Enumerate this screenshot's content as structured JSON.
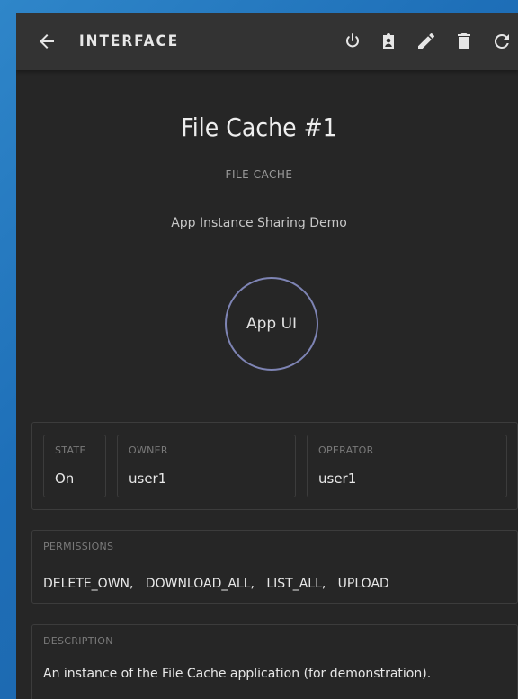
{
  "header": {
    "title": "INTERFACE",
    "icons": [
      "arrow-back-icon",
      "power-icon",
      "badge-icon",
      "pencil-icon",
      "trash-icon",
      "refresh-icon"
    ]
  },
  "app": {
    "title": "File Cache #1",
    "type": "FILE CACHE",
    "subtitle": "App Instance Sharing Demo",
    "ui_button_label": "App UI"
  },
  "info": {
    "state_label": "STATE",
    "state_value": "On",
    "owner_label": "OWNER",
    "owner_value": "user1",
    "operator_label": "OPERATOR",
    "operator_value": "user1"
  },
  "permissions": {
    "label": "PERMISSIONS",
    "value": "DELETE_OWN,   DOWNLOAD_ALL,   LIST_ALL,   UPLOAD"
  },
  "description": {
    "label": "DESCRIPTION",
    "value": "An instance of the File Cache application (for demonstration)."
  },
  "colors": {
    "panel_bg": "#262626",
    "topbar_bg": "#333333",
    "circle_border": "#7e84b4",
    "backdrop": "#2f86c9"
  }
}
